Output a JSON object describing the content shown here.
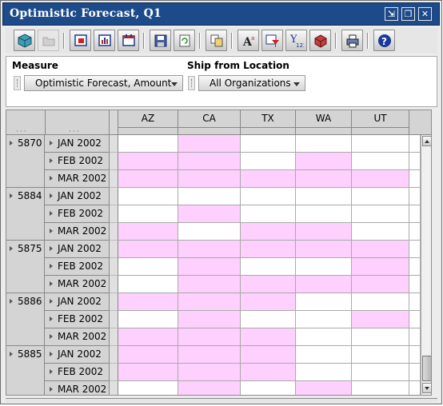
{
  "window": {
    "title": "Optimistic Forecast, Q1"
  },
  "title_buttons": [
    {
      "name": "minimize-button",
      "glyph": "⇲"
    },
    {
      "name": "restore-button",
      "glyph": "❐"
    },
    {
      "name": "close-button",
      "glyph": "✕"
    }
  ],
  "toolbar": {
    "icons": [
      "cube-icon",
      "open-folder-icon",
      "chart-table-icon",
      "bar-chart-icon",
      "calendar-table-icon",
      "save-icon",
      "refresh-icon",
      "copy-icon",
      "font-size-icon",
      "filter-icon",
      "formula-icon",
      "export-icon",
      "print-icon",
      "help-icon"
    ]
  },
  "params": {
    "measure": {
      "label": "Measure",
      "value": "Optimistic Forecast, Amount"
    },
    "ship_from": {
      "label": "Ship from Location",
      "value": "All Organizations"
    }
  },
  "grid": {
    "columns": [
      "AZ",
      "CA",
      "TX",
      "WA",
      "UT"
    ],
    "items": [
      {
        "id": "5870",
        "months": [
          "JAN 2002",
          "FEB 2002",
          "MAR 2002"
        ]
      },
      {
        "id": "5884",
        "months": [
          "JAN 2002",
          "FEB 2002",
          "MAR 2002"
        ]
      },
      {
        "id": "5875",
        "months": [
          "JAN 2002",
          "FEB 2002",
          "MAR 2002"
        ]
      },
      {
        "id": "5886",
        "months": [
          "JAN 2002",
          "FEB 2002",
          "MAR 2002"
        ]
      },
      {
        "id": "5885",
        "months": [
          "JAN 2002",
          "FEB 2002",
          "MAR 2002"
        ]
      }
    ],
    "cell_pattern": [
      [
        0,
        1,
        0,
        0,
        0
      ],
      [
        1,
        1,
        0,
        1,
        0
      ],
      [
        1,
        1,
        1,
        1,
        1
      ],
      [
        0,
        0,
        0,
        0,
        0
      ],
      [
        0,
        1,
        0,
        0,
        0
      ],
      [
        1,
        0,
        1,
        1,
        0
      ],
      [
        1,
        1,
        1,
        1,
        1
      ],
      [
        0,
        1,
        0,
        0,
        1
      ],
      [
        0,
        1,
        1,
        1,
        1
      ],
      [
        1,
        1,
        1,
        0,
        0
      ],
      [
        0,
        1,
        0,
        0,
        1
      ],
      [
        1,
        1,
        1,
        0,
        0
      ],
      [
        1,
        1,
        1,
        0,
        0
      ],
      [
        1,
        1,
        1,
        0,
        0
      ],
      [
        0,
        1,
        0,
        1,
        0
      ]
    ],
    "colors": {
      "pink": "#fdd0fd",
      "white": "#ffffff"
    }
  }
}
